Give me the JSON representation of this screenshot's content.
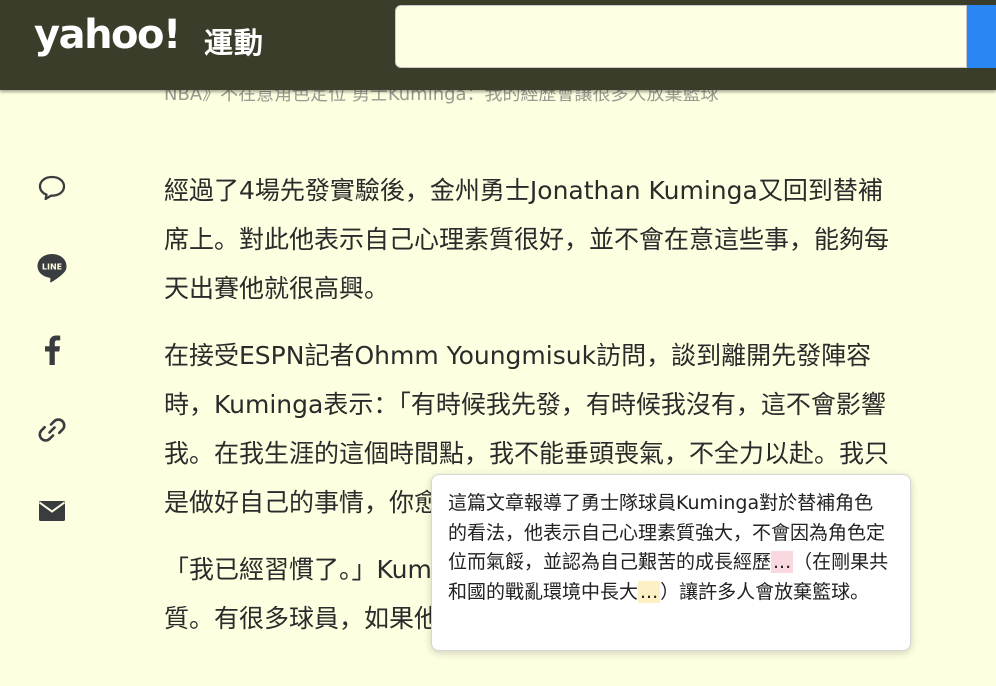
{
  "header": {
    "logo_text": "yahoo!",
    "section_label": "運動",
    "search_value": "",
    "search_placeholder": ""
  },
  "breadcrumb": "NBA》不在意角色定位 勇士Kuminga：我的經歷會讓很多人放棄籃球",
  "share": {
    "icons": [
      "comment-icon",
      "line-icon",
      "facebook-icon",
      "link-icon",
      "mail-icon"
    ],
    "line_label": "LINE"
  },
  "article": {
    "paragraphs": [
      "經過了4場先發實驗後，金州勇士Jonathan Kuminga又回到替補席上。對此他表示自己心理素質很好，並不會在意這些事，能夠每天出賽他就很高興。",
      "在接受ESPN記者Ohmm Youngmisuk訪問，談到離開先發陣容時，Kuminga表示：「有時候我先發，有時候我沒有，這不會影響我。在我生涯的這個時間點，我不能垂頭喪氣，不全力以赴。我只是做好自己的事情，你愈擔心，就愈會影響到你。」",
      "「我已經習慣了。」Kuminga說，他認為自己有著強悍的心理素質。有很多球員，如果他們經歷過我經歷過的"
    ]
  },
  "tooltip": {
    "text_1": "這篇文章報導了勇士隊球員Kuminga對於替補角色的看法，他表示自己心理素質強大，不會因為角色定位而氣餒，並認為自己艱苦的成長經歷",
    "ellipsis_1": "...",
    "text_2": "（在剛果共和國的戰亂環境中長大",
    "ellipsis_2": "...",
    "text_3": "）讓許多人會放棄籃球。"
  },
  "colors": {
    "header_bg": "#3a3d2a",
    "page_bg": "#fefee0",
    "search_button": "#2a86f2",
    "icon_color": "#3a3d40"
  }
}
